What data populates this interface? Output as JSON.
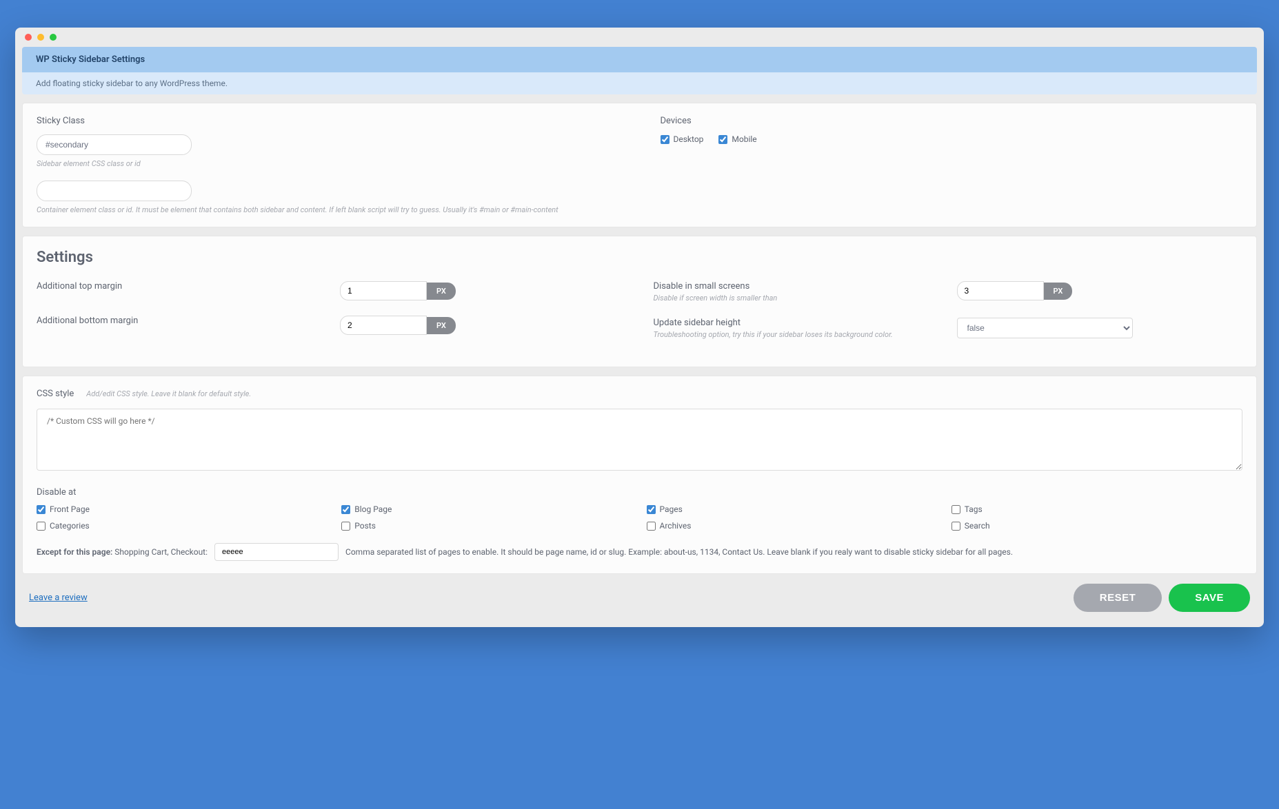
{
  "header": {
    "title": "WP Sticky Sidebar Settings",
    "subtitle": "Add floating sticky sidebar to any WordPress theme."
  },
  "sticky": {
    "label": "Sticky Class",
    "value": "#secondary",
    "hint": "Sidebar element CSS class or id",
    "container_value": "",
    "container_hint": "Container element class or id. It must be element that contains both sidebar and content. If left blank script will try to guess. Usually it's #main or #main-content"
  },
  "devices": {
    "label": "Devices",
    "desktop": "Desktop",
    "mobile": "Mobile"
  },
  "settings": {
    "title": "Settings",
    "top_margin": {
      "label": "Additional top margin",
      "value": "1",
      "unit": "PX"
    },
    "bottom_margin": {
      "label": "Additional bottom margin",
      "value": "2",
      "unit": "PX"
    },
    "disable_small": {
      "label": "Disable in small screens",
      "hint": "Disable if screen width is smaller than",
      "value": "3",
      "unit": "PX"
    },
    "update_height": {
      "label": "Update sidebar height",
      "hint": "Troubleshooting option, try this if your sidebar loses its background color.",
      "value": "false"
    }
  },
  "css": {
    "label": "CSS style",
    "hint": "Add/edit CSS style. Leave it blank for default style.",
    "placeholder": "/* Custom CSS will go here */"
  },
  "disable": {
    "label": "Disable at",
    "items": {
      "front": "Front Page",
      "blog": "Blog Page",
      "pages": "Pages",
      "tags": "Tags",
      "categories": "Categories",
      "posts": "Posts",
      "archives": "Archives",
      "search": "Search"
    }
  },
  "except": {
    "label": "Except for this page:",
    "sample": "Shopping Cart, Checkout:",
    "value": "eeeee",
    "hint": "Comma separated list of pages to enable. It should be page name, id or slug. Example: about-us, 1134, Contact Us. Leave blank if you realy want to disable sticky sidebar for all pages."
  },
  "footer": {
    "review": "Leave a review",
    "reset": "RESET",
    "save": "SAVE"
  }
}
